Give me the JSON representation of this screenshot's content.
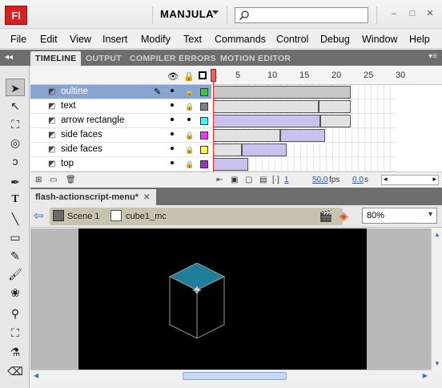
{
  "app": {
    "logo": "Fl",
    "workspace": "MANJULA",
    "window_controls": [
      "–",
      "□",
      "✕"
    ]
  },
  "menu": [
    "File",
    "Edit",
    "View",
    "Insert",
    "Modify",
    "Text",
    "Commands",
    "Control",
    "Debug",
    "Window",
    "Help"
  ],
  "panel_tabs": [
    "TIMELINE",
    "OUTPUT",
    "COMPILER ERRORS",
    "MOTION EDITOR"
  ],
  "timeline": {
    "frame_numbers": [
      "1",
      "5",
      "10",
      "15",
      "20",
      "25",
      "30"
    ],
    "layers": [
      {
        "name": "oultine",
        "selected": true,
        "color": "#33cc33"
      },
      {
        "name": "text",
        "selected": false,
        "color": "#808080"
      },
      {
        "name": "arrow rectangle",
        "selected": false,
        "color": "#33ffff"
      },
      {
        "name": "side faces",
        "selected": false,
        "color": "#ff33ff"
      },
      {
        "name": "side faces",
        "selected": false,
        "color": "#ffff33"
      },
      {
        "name": "top",
        "selected": false,
        "color": "#9933cc"
      }
    ],
    "current_frame": "1",
    "fps": "50.0",
    "fps_unit": "fps",
    "time": "0.0",
    "time_unit": "s"
  },
  "document": {
    "tab_label": "flash-actionscript-menu*",
    "close": "✕"
  },
  "editbar": {
    "scene": "Scene 1",
    "symbol": "cube1_mc",
    "zoom": "80%"
  },
  "colors": {
    "cube_top": "#1f7f9a",
    "stage_bg": "#000000",
    "selected_layer": "#8aa4d0"
  }
}
